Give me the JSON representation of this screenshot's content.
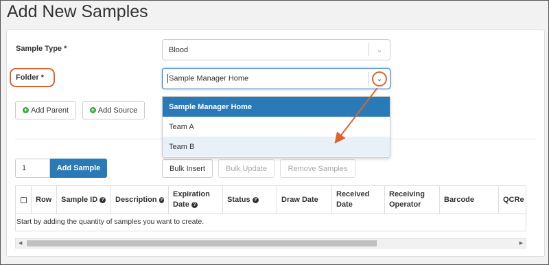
{
  "page": {
    "title": "Add New Samples"
  },
  "form": {
    "sample_type_label": "Sample Type *",
    "sample_type_value": "Blood",
    "folder_label": "Folder *",
    "folder_value": "Sample Manager Home"
  },
  "buttons": {
    "add_parent": "Add Parent",
    "add_source": "Add Source",
    "add_sample": "Add Sample",
    "bulk_insert": "Bulk Insert",
    "bulk_update": "Bulk Update",
    "remove_samples": "Remove Samples"
  },
  "folder_options": [
    {
      "label": "Sample Manager Home",
      "selected": true
    },
    {
      "label": "Team A",
      "selected": false
    },
    {
      "label": "Team B",
      "selected": false
    }
  ],
  "quantity": "1",
  "grid": {
    "columns": [
      {
        "label": "",
        "has_help": false,
        "is_checkbox": true
      },
      {
        "label": "Row",
        "has_help": false
      },
      {
        "label": "Sample ID",
        "has_help": true
      },
      {
        "label": "Description",
        "has_help": true
      },
      {
        "label": "Expiration Date",
        "has_help": true
      },
      {
        "label": "Status",
        "has_help": true
      },
      {
        "label": "Draw Date",
        "has_help": false
      },
      {
        "label": "Received Date",
        "has_help": false
      },
      {
        "label": "Receiving Operator",
        "has_help": false
      },
      {
        "label": "Barcode",
        "has_help": false
      },
      {
        "label": "QCRe",
        "has_help": false
      }
    ],
    "empty_message": "Start by adding the quantity of samples you want to create."
  },
  "colors": {
    "accent": "#2a7ab8",
    "highlight": "#e0622b",
    "plus": "#3aa73a"
  }
}
